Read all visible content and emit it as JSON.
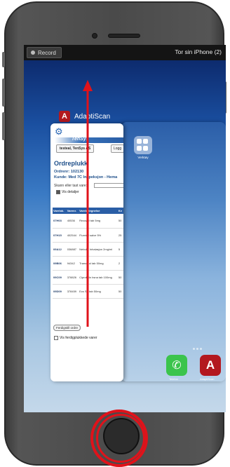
{
  "status_bar": {
    "record_label": "Record",
    "device_name": "Tor sin iPhone (2)"
  },
  "switcher": {
    "app_name": "AdaptiScan",
    "app_icon_letter": "A"
  },
  "front_card": {
    "logo": "TenSys",
    "user_button": "testeal, TenSys AS",
    "logout_button": "Logg",
    "title": "Ordreplukk",
    "order_line": "Ordrenr: 102130",
    "customer_line": "Kunde: Med 7C Inspeksjon - Hema",
    "scan_label": "Skann eller tast vare:",
    "show_details": "Vis detaljer",
    "table_headers": [
      "Varelok.",
      "Varenr.",
      "Varebetegnelse",
      "Kv"
    ],
    "rows": [
      {
        "loc": "07H03",
        "nr": "40536",
        "desc": "Rezazol tab 5mg",
        "qty": "50"
      },
      {
        "loc": "07H15",
        "nr": "402544",
        "desc": "Flumidil salve 5%",
        "qty": "25"
      },
      {
        "loc": "09A12",
        "nr": "036887",
        "desc": "Nebulin Inhalasjon 2mg/ml",
        "qty": "5"
      },
      {
        "loc": "09B06",
        "nr": "94342",
        "desc": "Tramadol tab 50mg",
        "qty": "2"
      },
      {
        "loc": "09C09",
        "nr": "378826",
        "desc": "Ciprofolin hsna tab 100mg",
        "qty": "50"
      },
      {
        "loc": "09D09",
        "nr": "378459",
        "desc": "Ecs SA tab 50mg",
        "qty": "50"
      }
    ],
    "finished_button": "Ferdigstill ordre",
    "show_finished": "Vis ferdigplukkede varer"
  },
  "back_card": {
    "folder_label": "Verktøy",
    "dock_phone_label": "Telefon",
    "dock_app_label": "AdaptiScan",
    "dock_app_letter": "A"
  },
  "colors": {
    "annotation_red": "#e0121a",
    "brand_blue": "#2a5ea6",
    "adaptiscan_red": "#b3181f"
  }
}
